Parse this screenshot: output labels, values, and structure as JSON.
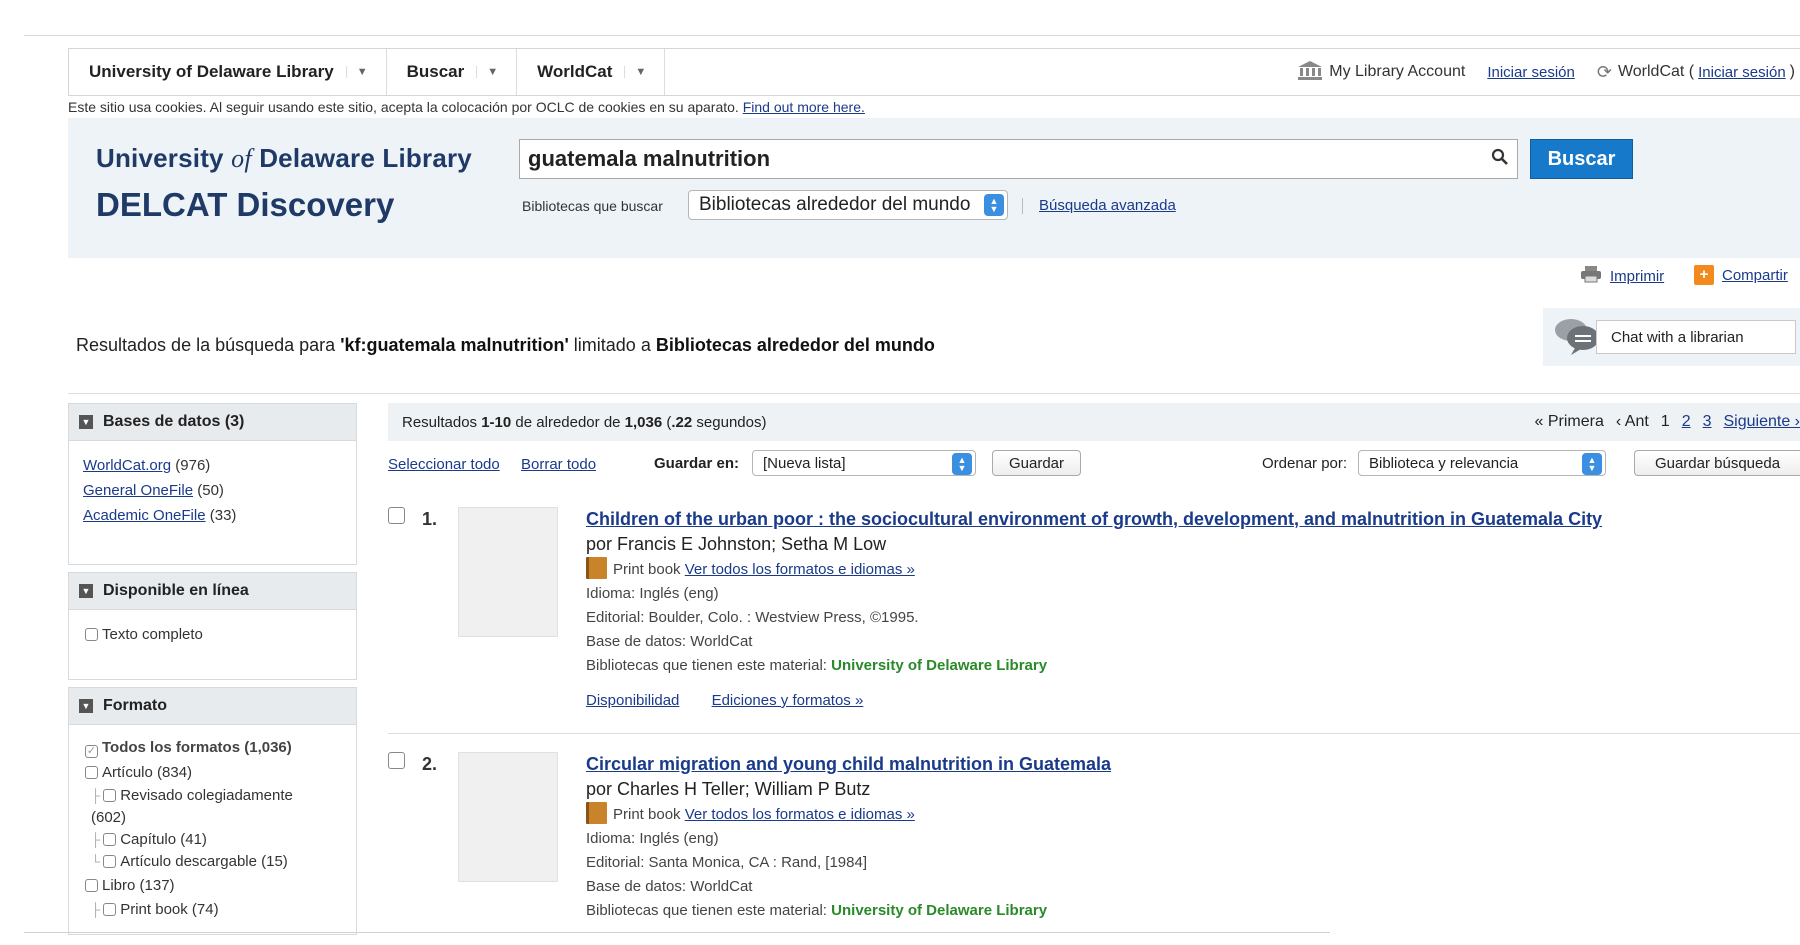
{
  "topbar": {
    "items": [
      {
        "label": "University of Delaware Library"
      },
      {
        "label": "Buscar"
      },
      {
        "label": "WorldCat"
      }
    ],
    "my_account": "My Library Account",
    "sign_in": "Iniciar sesión",
    "worldcat_prefix": "WorldCat (",
    "worldcat_signin": "Iniciar sesión",
    "worldcat_suffix": ")"
  },
  "cookie": {
    "text": "Este sitio usa cookies. Al seguir usando este sitio, acepta la colocación por OCLC de cookies en su aparato. ",
    "link": "Find out more here."
  },
  "brand": {
    "line1_a": "University ",
    "line1_of": "of",
    "line1_b": " Delaware Library",
    "line2": "DELCAT Discovery"
  },
  "search": {
    "query": "guatemala malnutrition",
    "button": "Buscar",
    "libraries_label": "Bibliotecas que buscar",
    "libraries_value": "Bibliotecas alrededor del mundo",
    "advanced": "Búsqueda avanzada"
  },
  "actions": {
    "print": "Imprimir",
    "share": "Compartir",
    "chat": "Chat with a librarian"
  },
  "results_for": {
    "prefix": "Resultados de la búsqueda para ",
    "query": "'kf:guatemala malnutrition'",
    "middle": " limitado a ",
    "scope": "Bibliotecas alrededor del mundo"
  },
  "facets": {
    "databases": {
      "title": "Bases de datos (3)",
      "items": [
        {
          "label": "WorldCat.org",
          "count": "(976)"
        },
        {
          "label": "General OneFile",
          "count": "(50)"
        },
        {
          "label": "Academic OneFile",
          "count": "(33)"
        }
      ]
    },
    "online": {
      "title": "Disponible en línea",
      "item": "Texto completo"
    },
    "format": {
      "title": "Formato",
      "all": "Todos los formatos",
      "all_count": "(1,036)",
      "article": "Artículo (834)",
      "peer": "Revisado colegiadamente",
      "peer_count": "(602)",
      "chapter": "Capítulo (41)",
      "downloadable": "Artículo descargable (15)",
      "book": "Libro (137)",
      "print_book": "Print book (74)"
    }
  },
  "results_bar": {
    "pre": "Resultados ",
    "range": "1-10",
    "mid": " de alrededor de ",
    "total": "1,036",
    "time_pre": " (",
    "time": ".22",
    "time_post": " segundos)",
    "first": "« Primera",
    "prev": "‹ Ant",
    "page1": "1",
    "page2": "2",
    "page3": "3",
    "next": "Siguiente ›"
  },
  "tools": {
    "select_all": "Seleccionar todo",
    "clear_all": "Borrar todo",
    "save_in": "Guardar en:",
    "list_value": "[Nueva lista]",
    "save": "Guardar",
    "sort_by": "Ordenar por:",
    "sort_value": "Biblioteca y relevancia",
    "save_search": "Guardar búsqueda"
  },
  "results": [
    {
      "num": "1.",
      "title": "Children of the urban poor : the sociocultural environment of growth, development, and malnutrition in Guatemala City",
      "author": "por Francis E Johnston; Setha M Low",
      "format": "Print book",
      "all_formats": "Ver todos los formatos e idiomas »",
      "language": "Idioma: Inglés (eng)",
      "publisher": "Editorial: Boulder, Colo. : Westview Press, ©1995.",
      "database": "Base de datos: WorldCat",
      "holdings_label": "Bibliotecas que tienen este material: ",
      "holdings_lib": "University of Delaware Library",
      "availability": "Disponibilidad",
      "editions": "Ediciones y formatos »"
    },
    {
      "num": "2.",
      "title": "Circular migration and young child malnutrition in Guatemala",
      "author": "por Charles H Teller; William P Butz",
      "format": "Print book",
      "all_formats": "Ver todos los formatos e idiomas »",
      "language": "Idioma: Inglés (eng)",
      "publisher": "Editorial: Santa Monica, CA : Rand, [1984]",
      "database": "Base de datos: WorldCat",
      "holdings_label": "Bibliotecas que tienen este material: ",
      "holdings_lib": "University of Delaware Library"
    }
  ]
}
